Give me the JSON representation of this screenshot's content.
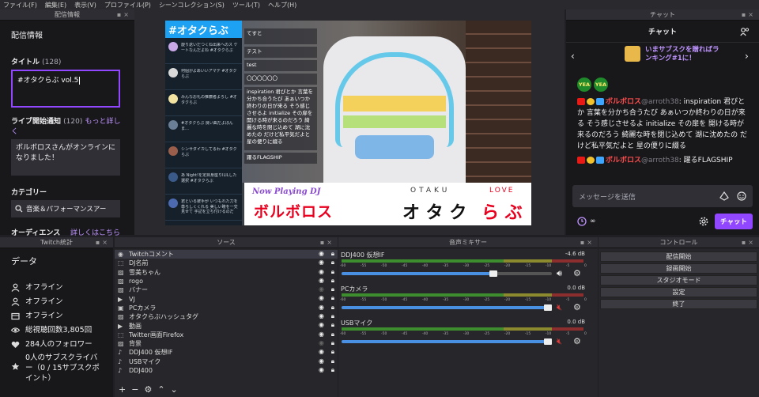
{
  "menubar": [
    "ファイル(F)",
    "編集(E)",
    "表示(V)",
    "プロファイル(P)",
    "シーンコレクション(S)",
    "ツール(T)",
    "ヘルプ(H)"
  ],
  "info_panel": {
    "dock_title": "配信情報",
    "heading": "配信情報",
    "title_label": "タイトル",
    "title_count": "(128)",
    "title_value": "#オタクらぶ vol.5",
    "notif_label": "ライブ開始通知",
    "notif_count": "(120)",
    "notif_more": "もっと詳しく",
    "notif_value": "ボルボロスさんがオンラインになりました！",
    "category_label": "カテゴリー",
    "category_value": "音楽＆パフォーマンスアー",
    "audience_label": "オーディエンス",
    "audience_more": "詳しくはこちら"
  },
  "preview": {
    "hashtag": "#オタクらぶ",
    "comments": [
      "てすと",
      "テスト",
      "test",
      "〇〇〇〇〇〇",
      "inspiration 君ぴとか 言葉を分かち合うたび あぁいつか終わりの日が来る そう感じさせるよ initialize その扉を 開ける時が来るのだろう 綺麗な時を閉じ込めて 湖に沈めたの だけど私平気だよと 星の便りに綴る",
      "躍るFLAGSHIP"
    ],
    "tweets": [
      {
        "time": "null",
        "text": "旋り返いだつくね出来へのス ケートなんだよね #オタクらぶ"
      },
      {
        "time": "null",
        "text": "何個がよあいいアマデ #オタクらぶ"
      },
      {
        "time": "null",
        "text": "みんなお礼の推薦者よろし #オタクらぶ"
      },
      {
        "time": "null",
        "text": "#オタクらぶ 良い曲だよほんま…"
      },
      {
        "time": "null",
        "text": "シンサダイカしてるわ #オタクらぶ"
      },
      {
        "time": "null",
        "text": "あ Night!を定目身座りILILした 選択 #オタクらぶ"
      },
      {
        "time": "null",
        "text": "君といる彼手が いつもれた力を尊ろしくくれる 美しい瞳を一交見せて 手記を立ち付けるのだ"
      }
    ],
    "now_playing_label": "Now Playing DJ",
    "dj_name": "ボルボロス",
    "otaku_label": "OTAKU",
    "love_label": "LOVE",
    "logo_main": "オ タ ク",
    "logo_sub": "ら ぶ"
  },
  "chat": {
    "dock_title": "チャット",
    "title": "チャット",
    "hype": "いまサブスクを贈ればランキング#1に！",
    "yea1": "YEA",
    "yea2": "YEA",
    "messages": [
      {
        "user": "ボルボロス",
        "id": "@arroth38",
        "text": ": inspiration 君ぴとか 言葉を分かち合うたび あぁいつか終わりの日が来る そう感じさせるよ initialize その扉を 開ける時が来るのだろう 綺麗な時を閉じ込めて 湖に沈めたの だけど私平気だよと 星の便りに綴る"
      },
      {
        "user": "ボルボロス",
        "id": "@arroth38",
        "text": ": 躍るFLAGSHIP"
      }
    ],
    "input_placeholder": "メッセージを送信",
    "points": "∞",
    "send_label": "チャット"
  },
  "stats_panel": {
    "dock_title": "Twitch統計",
    "heading": "データ",
    "rows": [
      {
        "icon": "user-icon",
        "text": "オフライン"
      },
      {
        "icon": "user-icon",
        "text": "オフライン"
      },
      {
        "icon": "video-icon",
        "text": "オフライン"
      },
      {
        "icon": "eye-icon",
        "text": "総視聴回数3,805回"
      },
      {
        "icon": "heart-icon",
        "text": "284人のフォロワー"
      },
      {
        "icon": "star-icon",
        "text": "0人のサブスクライバー（0 / 15サブスクポイント）"
      }
    ]
  },
  "sources": {
    "dock_title": "ソース",
    "items": [
      "Twitchコメント",
      "DJ名前",
      "雪美ちゃん",
      "rogo",
      "バナー",
      "VJ",
      "PCカメラ",
      "オタクらぶハッシュタグ",
      "動画",
      "Twitter画面Firefox",
      "背景",
      "DDJ400 仮想IF",
      "USBマイク",
      "DDJ400"
    ]
  },
  "mixer": {
    "dock_title": "音声ミキサー",
    "channels": [
      {
        "name": "DDJ400 仮想IF",
        "level": "-4.6 dB",
        "fader": 0.72,
        "muted": false
      },
      {
        "name": "PCカメラ",
        "level": "0.0 dB",
        "fader": 0.98,
        "muted": true
      },
      {
        "name": "USBマイク",
        "level": "0.0 dB",
        "fader": 0.98,
        "muted": true
      }
    ],
    "scale": [
      "-60",
      "-55",
      "-50",
      "-45",
      "-40",
      "-35",
      "-30",
      "-25",
      "-20",
      "-15",
      "-10",
      "-5",
      "0"
    ]
  },
  "controls": {
    "dock_title": "コントロール",
    "buttons": [
      "配信開始",
      "録画開始",
      "スタジオモード",
      "設定",
      "終了"
    ]
  }
}
